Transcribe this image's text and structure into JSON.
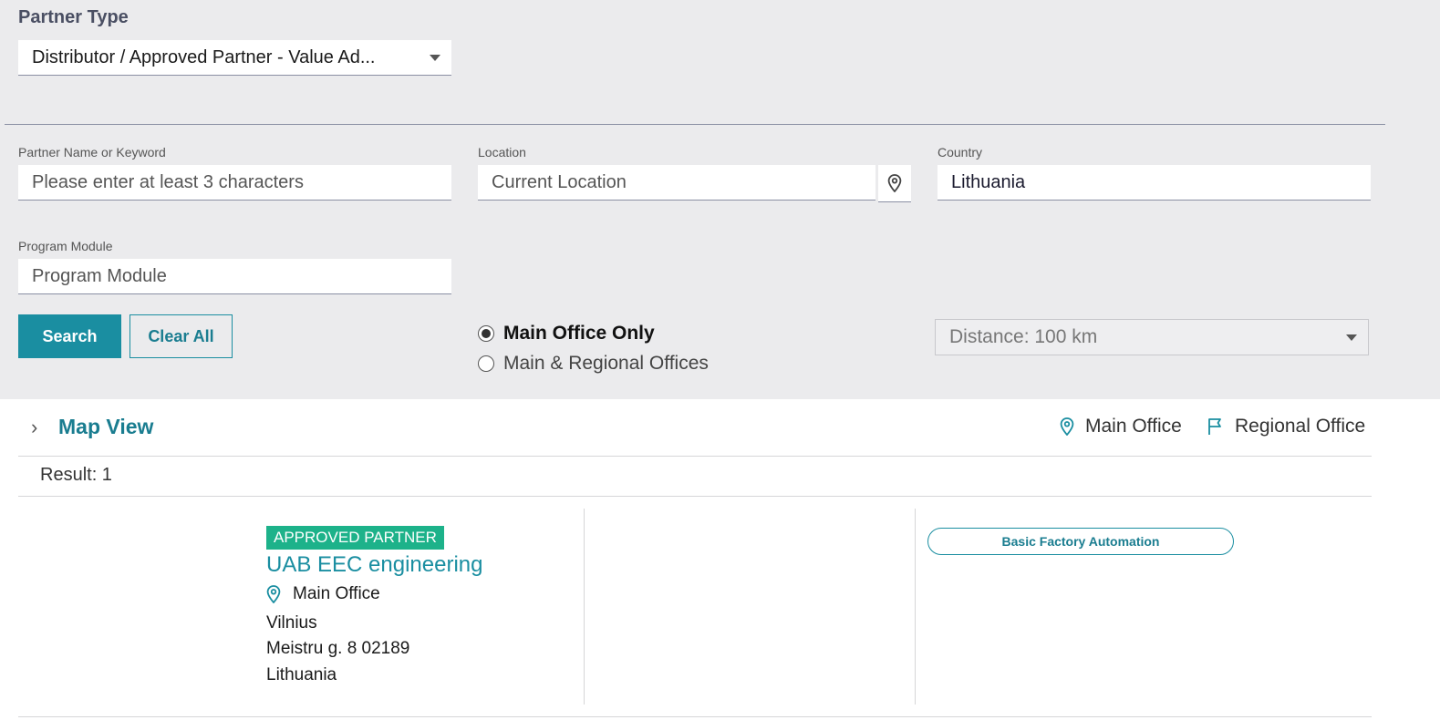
{
  "filters": {
    "partner_type_label": "Partner Type",
    "partner_type_value": "Distributor / Approved Partner - Value Ad...",
    "keyword_label": "Partner Name or Keyword",
    "keyword_placeholder": "Please enter at least 3 characters",
    "location_label": "Location",
    "location_placeholder": "Current Location",
    "country_label": "Country",
    "country_value": "Lithuania",
    "program_module_label": "Program Module",
    "program_module_placeholder": "Program Module",
    "search_label": "Search",
    "clear_label": "Clear All",
    "office_options": [
      {
        "label": "Main Office Only",
        "selected": true
      },
      {
        "label": "Main & Regional Offices",
        "selected": false
      }
    ],
    "distance_value": "Distance: 100 km"
  },
  "map": {
    "toggle_label": "Map View",
    "legend_main": "Main Office",
    "legend_regional": "Regional Office"
  },
  "results": {
    "count_label": "Result: 1",
    "items": [
      {
        "badge": "APPROVED PARTNER",
        "name": "UAB EEC engineering",
        "office_type": "Main Office",
        "city": "Vilnius",
        "street": "Meistru g. 8 02189",
        "country": "Lithuania",
        "module": "Basic Factory Automation"
      }
    ]
  },
  "colors": {
    "accent": "#1a8ea1",
    "badge": "#1db28a",
    "panel": "#ebebed"
  }
}
